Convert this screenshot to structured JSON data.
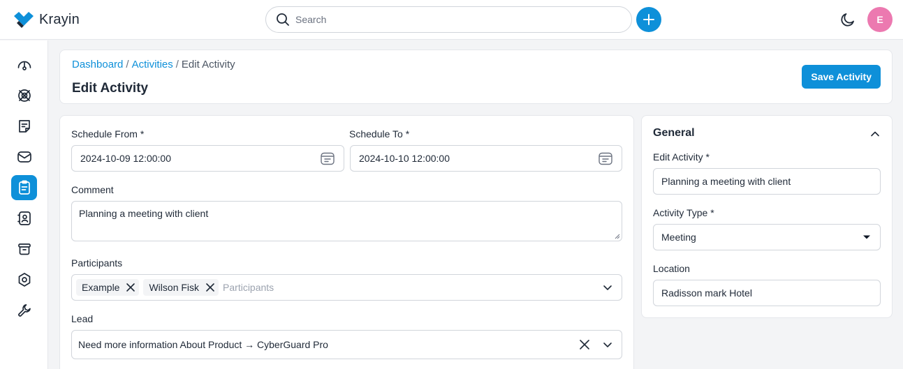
{
  "app": {
    "name": "Krayin"
  },
  "topbar": {
    "search_placeholder": "Search",
    "avatar_initial": "E"
  },
  "sidebar": {
    "items": [
      {
        "icon": "dashboard-icon",
        "active": false
      },
      {
        "icon": "leads-icon",
        "active": false
      },
      {
        "icon": "quotes-icon",
        "active": false
      },
      {
        "icon": "mail-icon",
        "active": false
      },
      {
        "icon": "activities-icon",
        "active": true
      },
      {
        "icon": "contacts-icon",
        "active": false
      },
      {
        "icon": "products-icon",
        "active": false
      },
      {
        "icon": "settings-icon",
        "active": false
      },
      {
        "icon": "configuration-icon",
        "active": false
      }
    ]
  },
  "header": {
    "breadcrumb": {
      "dashboard": "Dashboard",
      "sep1": "/",
      "activities": "Activities",
      "sep2": "/",
      "current": "Edit Activity"
    },
    "title": "Edit Activity",
    "save_label": "Save Activity"
  },
  "form": {
    "schedule_from_label": "Schedule From *",
    "schedule_from_value": "2024-10-09 12:00:00",
    "schedule_to_label": "Schedule To *",
    "schedule_to_value": "2024-10-10 12:00:00",
    "comment_label": "Comment",
    "comment_value": "Planning a meeting with client",
    "participants_label": "Participants",
    "participants": [
      "Example",
      "Wilson Fisk"
    ],
    "participants_placeholder": "Participants",
    "lead_label": "Lead",
    "lead_value": "Need more information About Product → CyberGuard Pro"
  },
  "general": {
    "title": "General",
    "edit_activity_label": "Edit Activity *",
    "edit_activity_value": "Planning a meeting with client",
    "activity_type_label": "Activity Type *",
    "activity_type_value": "Meeting",
    "location_label": "Location",
    "location_value": "Radisson mark Hotel"
  },
  "colors": {
    "accent": "#0e90d9",
    "avatar": "#ec79b0"
  }
}
